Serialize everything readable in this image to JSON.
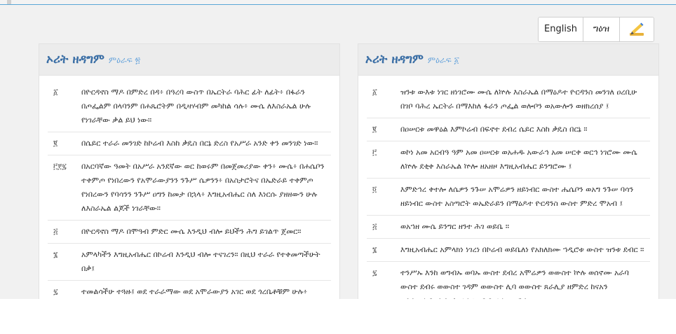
{
  "lang_switch": {
    "english": "English",
    "geez": "ግዕዝ",
    "pen_icon": "pen-writing-icon"
  },
  "panels": [
    {
      "title": "ኦሪት ዘዳግም",
      "subtitle": "ምዕራፍ ፳",
      "verses": [
        {
          "num": "፩",
          "text": "በዮርዳኖስ ማዶ በምድረ በዳ፥ በዓረባ ውስጥ በኤርትራ ባሕር ፊት ለፊት፥ በፋራን በጦፌልም በላባንም በሐጼሮትም በዲዛሃብም መካከል ሳሉ፥ ሙሴ ለእስራኤል ሁሉ የነገራቸው ቃል ይህ ነው።"
        },
        {
          "num": "፪",
          "text": "በሴይር ተራራ መንገድ ከኮሬብ እስከ ቃዴስ በርኔ ድረስ የአሥራ አንድ ቀን መንገድ ነው።"
        },
        {
          "num": "፫፻፯",
          "text": "በአርባኛው ዓመት በአሥራ አንደኛው ወር ከወሩም በመጀመሪያው ቀን፥ ሙሴ፥ በሐሴቦን ተቀምጦ የነበረውን የአሞራውያንን ንጉሥ ሴዎንን፥ በአስታሮትና በኤድራይ ተቀምጦ የነበረውን የባሳንን ንጉሥ ዐግን ከመታ በኋላ፥ እግዚአብሔር ስለ እነርሱ ያዘዘውን ሁሉ ለእስራኤል ልጆች ነገራቸው።"
        },
        {
          "num": "፭",
          "text": "በዮርዳኖስ ማዶ በሞዓብ ምድር ሙሴ እንዲህ ብሎ ይህችን ሕግ ይገልጥ ጀመር።"
        },
        {
          "num": "፮",
          "text": "አምላካችን እግዚአብሔር በኮሬብ እንዲህ ብሎ ተናገረን። በዚህ ተራራ የተቀመጣችሁት በቃ፤"
        },
        {
          "num": "፯",
          "text": "ተመልሳችሁ ተጓዙ፤ ወደ ተራራማው ወደ አሞራውያን አገር ወደ ጎረቤቶቹም ሁሉ፥"
        }
      ]
    },
    {
      "title": "ኦሪት ዘዳግም",
      "subtitle": "ምዕራፍ ፩",
      "verses": [
        {
          "num": "፩",
          "text": "ዝንቱ ውእቱ ነገር ዘነገሮሙ ሙሴ ለኵሉ እስራኤል በማዕዶተ ዮርዳንስ መንገለ ዐረቢሁ በገቦ ባሕረ ኤርትራ በማእከለ ፋራን ጦፌል ወሎቦን ወአውሎን ወዘክረሰያ ፤"
        },
        {
          "num": "፪",
          "text": "በዐሠርቱ መዋዕል እምኮሬብ በፍኖተ ደብረ ሴይር እስከ ቃዴስ በርኔ ።"
        },
        {
          "num": "፫",
          "text": "ወኮነ አመ አርብዓ ዓም አመ ዐሠርቱ ወአሐዱ አውራኅ አመ ሠርቀ ወርኅ ነገሮሙ ሙሴ ለኵሉ ደቂቀ እስራኤል ኵሎ ዘአዘዞ እግዚአብሔር ይንግሮሙ ፤"
        },
        {
          "num": "፬",
          "text": "እምድኅረ ቀተሎ ለሴዎን ንጉሠ አሞሬዎን ዘይነብር ውስተ ሔሴቦን ወአግ ንጉሠ ባሳን ዘይነብር ውስተ አስጣሮት ወኤድራይን በማዕዶተ ዮርዳንስ ውስተ ምድረ ሞአብ ፤"
        },
        {
          "num": "፭",
          "text": "ወአኀዘ ሙሴ ይንግር ዘንተ ሕገ ወይቤ ።"
        },
        {
          "num": "፮",
          "text": "እግዚአብሔር አምላክነ ነገረነ በኮሬብ ወይቤለነ የአክለክሙ ኀዲሮቱ ውስተ ዝንቱ ደብር ።"
        },
        {
          "num": "፯",
          "text": "ተንሥኡ እንከ ወግብኡ ወባኡ ውስተ ደብረ አሞሬዎን ወውስተ ኵሉ ወሰኖሙ አራባ ውስተ ደብሩ ወውስተ ገዳም ወውስተ ሊባ ወውስተ ጸራሊያ ዘምድረ ከናአን ወእንጢሊባኖን እስከ ፈለግ ዐቢይ ፈለገ ኤፍራጥስ ።"
        }
      ]
    }
  ]
}
